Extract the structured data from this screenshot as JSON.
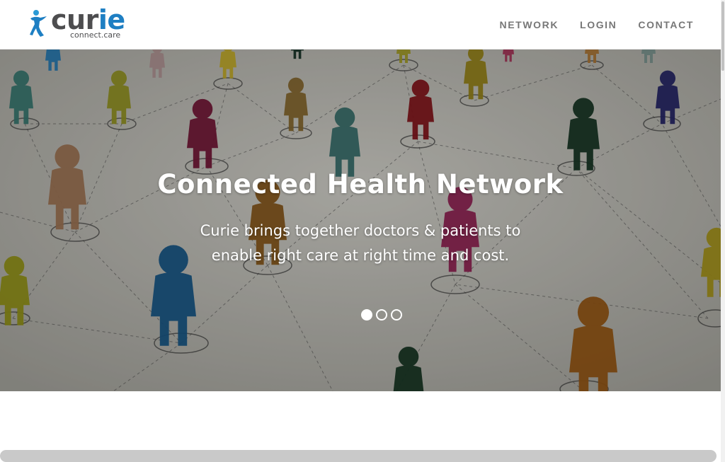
{
  "brand": {
    "name_prefix": "cur",
    "name_accent": "ie",
    "tagline": "connect.care",
    "accent_color": "#1e7fc3",
    "text_color": "#4d4d4f"
  },
  "nav": {
    "items": [
      {
        "label": "NETWORK"
      },
      {
        "label": "LOGIN"
      },
      {
        "label": "CONTACT"
      }
    ]
  },
  "hero": {
    "title": "Connected Health Network",
    "subtitle": "Curie brings together doctors & patients to enable right care at right time and cost.",
    "background_image": "network-of-people-figures",
    "slides": {
      "count": 3,
      "active_index": 0
    }
  },
  "icons": {
    "logo": "person-figure-icon"
  }
}
